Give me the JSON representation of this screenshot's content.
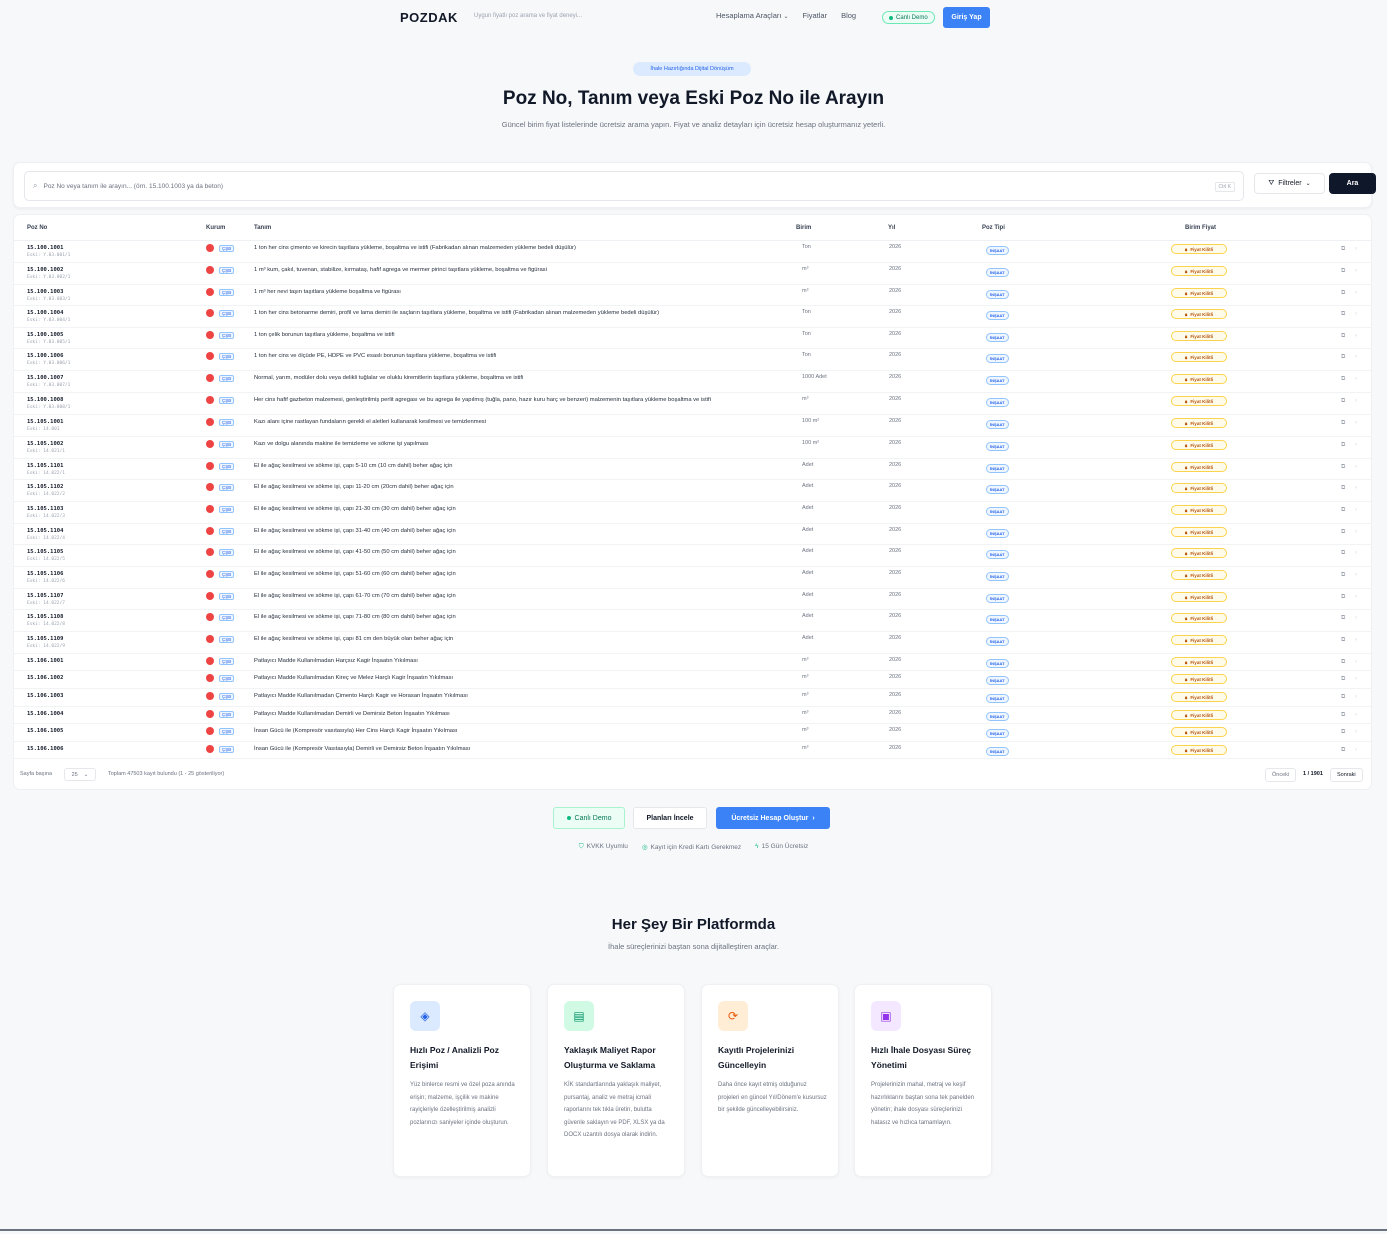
{
  "header": {
    "logo": "POZDAK",
    "search_hint": "Uygun fiyatlı poz arama ve fiyat deneyi...",
    "nav": [
      "Hesaplama Araçları",
      "Fiyatlar",
      "Blog"
    ],
    "demo_label": "Canlı Demo",
    "login_label": "Giriş Yap"
  },
  "hero": {
    "badge": "İhale Hazırlığında Dijital Dönüşüm",
    "title": "Poz No, Tanım veya Eski Poz No ile Arayın",
    "subtitle": "Güncel birim fiyat listelerinde ücretsiz arama yapın. Fiyat ve analiz detayları için ücretsiz hesap oluşturmanız yeterli."
  },
  "search": {
    "placeholder": "Poz No veya tanım ile arayın... (örn. 15.100.1003 ya da beton)",
    "kbd": "Ctrl K",
    "filters_label": "Filtreler",
    "search_label": "Ara"
  },
  "table": {
    "columns": [
      "Poz No",
      "Kurum",
      "Tanım",
      "Birim",
      "Yıl",
      "Poz Tipi",
      "Birim Fiyat"
    ],
    "inst_label": "ÇŞB",
    "type_label": "İNŞAAT",
    "price_label": "Fiyat Kilitli",
    "rows": [
      {
        "code": "15.100.1001",
        "old": "Eski: Y.03.001/1",
        "desc": "1 ton her cins çimento ve kirecin taşıtlara yükleme, boşaltma ve istifi (Fabrikadan alınan malzemeden yükleme bedeli düşülür)",
        "unit": "Ton",
        "year": "2026"
      },
      {
        "code": "15.100.1002",
        "old": "Eski: Y.03.002/1",
        "desc": "1 m³ kum, çakıl, tuvenan, stabilize, kırmataş, hafif agrega ve mermer pirinci taşıtlara yükleme, boşaltma ve figürasi",
        "unit": "m³",
        "year": "2026"
      },
      {
        "code": "15.100.1003",
        "old": "Eski: Y.03.003/1",
        "desc": "1 m³ her nevi taşın taşıtlara yükleme boşaltma ve figürası",
        "unit": "m³",
        "year": "2026"
      },
      {
        "code": "15.100.1004",
        "old": "Eski: Y.03.004/1",
        "desc": "1 ton her cins betonarme demiri, profil ve lama demiri ile saçların taşıtlara yükleme, boşaltma ve istifi (Fabrikadan alınan malzemeden yükleme bedeli düşülür)",
        "unit": "Ton",
        "year": "2026"
      },
      {
        "code": "15.100.1005",
        "old": "Eski: Y.03.005/1",
        "desc": "1 ton çelik borunun taşıtlara yükleme, boşaltma ve istifi",
        "unit": "Ton",
        "year": "2026"
      },
      {
        "code": "15.100.1006",
        "old": "Eski: Y.03.006/1",
        "desc": "1 ton her cins ve ölçüde PE, HDPE ve PVC esaslı borunun taşıtlara yükleme, boşaltma ve istifi",
        "unit": "Ton",
        "year": "2026"
      },
      {
        "code": "15.100.1007",
        "old": "Eski: Y.03.007/1",
        "desc": "Normal, yarım, modüler dolu veya delikli tuğlalar ve oluklu kiremitlerin taşıtlara yükleme, boşaltma ve istifi",
        "unit": "1000 Adet",
        "year": "2026"
      },
      {
        "code": "15.100.1008",
        "old": "Eski: Y.03.008/1",
        "desc": "Her cins hafif gazbeton malzemesi, genleştirilmiş perlit agregası ve bu agrega ile yapılmış (tuğla, pano, hazır kuru harç ve benzeri) malzemenin taşıtlara yükleme boşaltma ve istifi",
        "unit": "m³",
        "year": "2026"
      },
      {
        "code": "15.105.1001",
        "old": "Eski: 14.001",
        "desc": "Kazı alanı içine rastlayan fundaların gerekli el aletleri kullanarak kesilmesi ve temizlenmesi",
        "unit": "100 m²",
        "year": "2026"
      },
      {
        "code": "15.105.1002",
        "old": "Eski: 14.021/1",
        "desc": "Kazı ve dolgu alanında makine ile temizleme ve sökme işi yapılması",
        "unit": "100 m²",
        "year": "2026"
      },
      {
        "code": "15.105.1101",
        "old": "Eski: 14.022/1",
        "desc": "El ile ağaç kesilmesi ve sökme işi, çapı 5-10 cm (10 cm dahil) beher ağaç için",
        "unit": "Adet",
        "year": "2026"
      },
      {
        "code": "15.105.1102",
        "old": "Eski: 14.022/2",
        "desc": "El ile ağaç kesilmesi ve sökme işi, çapı 11-20 cm (20cm dahil) beher ağaç için",
        "unit": "Adet",
        "year": "2026"
      },
      {
        "code": "15.105.1103",
        "old": "Eski: 14.022/3",
        "desc": "El ile ağaç kesilmesi ve sökme işi, çapı 21-30 cm (30 cm dahil) beher ağaç için",
        "unit": "Adet",
        "year": "2026"
      },
      {
        "code": "15.105.1104",
        "old": "Eski: 14.022/4",
        "desc": "El ile ağaç kesilmesi ve sökme işi, çapı 31-40 cm (40 cm dahil) beher ağaç için",
        "unit": "Adet",
        "year": "2026"
      },
      {
        "code": "15.105.1105",
        "old": "Eski: 14.022/5",
        "desc": "El ile ağaç kesilmesi ve sökme işi, çapı 41-50 cm (50 cm dahil) beher ağaç için",
        "unit": "Adet",
        "year": "2026"
      },
      {
        "code": "15.105.1106",
        "old": "Eski: 14.022/6",
        "desc": "El ile ağaç kesilmesi ve sökme işi, çapı 51-60 cm (60 cm dahil) beher ağaç için",
        "unit": "Adet",
        "year": "2026"
      },
      {
        "code": "15.105.1107",
        "old": "Eski: 14.022/7",
        "desc": "El ile ağaç kesilmesi ve sökme işi, çapı 61-70 cm (70 cm dahil) beher ağaç için",
        "unit": "Adet",
        "year": "2026"
      },
      {
        "code": "15.105.1108",
        "old": "Eski: 14.022/8",
        "desc": "El ile ağaç kesilmesi ve sökme işi, çapı 71-80 cm (80 cm dahil) beher ağaç için",
        "unit": "Adet",
        "year": "2026"
      },
      {
        "code": "15.105.1109",
        "old": "Eski: 14.022/9",
        "desc": "El ile ağaç kesilmesi ve sökme işi, çapı 81 cm den büyük olan beher ağaç için",
        "unit": "Adet",
        "year": "2026"
      },
      {
        "code": "15.106.1001",
        "old": "",
        "desc": "Patlayıcı Madde Kullanılmadan Harçsız Kagir İnşaatın Yıkılması",
        "unit": "m³",
        "year": "2026"
      },
      {
        "code": "15.106.1002",
        "old": "",
        "desc": "Patlayıcı Madde Kullanılmadan Kireç ve Melez Harçlı Kagir İnşaatın Yıkılması",
        "unit": "m³",
        "year": "2026"
      },
      {
        "code": "15.106.1003",
        "old": "",
        "desc": "Patlayıcı Madde Kullanılmadan Çimento Harçlı Kagir ve Horasan İnşaatın Yıkılması",
        "unit": "m³",
        "year": "2026"
      },
      {
        "code": "15.106.1004",
        "old": "",
        "desc": "Patlayıcı Madde Kullanılmadan Demirli ve Demirsiz Beton İnşaatın Yıkılması",
        "unit": "m³",
        "year": "2026"
      },
      {
        "code": "15.106.1005",
        "old": "",
        "desc": "İnsan Gücü ile (Kompresör vasıtasıyla) Her Cins Harçlı Kagir İnşaatın Yıkılması",
        "unit": "m³",
        "year": "2026"
      },
      {
        "code": "15.106.1006",
        "old": "",
        "desc": "İnsan Gücü ile (Kompresör Vasıtasıyla) Demirli ve Demirsiz Beton İnşaatın Yıkılması",
        "unit": "m³",
        "year": "2026"
      }
    ],
    "footer": {
      "page_size_label": "Sayfa başına",
      "page_size": "25",
      "summary": "Toplam 47503 kayıt bulundu (1 - 25 gösteriliyor)",
      "prev": "Önceki",
      "page": "1 / 1901",
      "next": "Sonraki"
    }
  },
  "cta": {
    "demo": "Canlı Demo",
    "plans": "Planları İncele",
    "signup": "Ücretsiz Hesap Oluştur"
  },
  "trust": [
    "KVKK Uyumlu",
    "Kayıt için Kredi Kartı Gerekmez",
    "15 Gün Ücretsiz"
  ],
  "features_section": {
    "title": "Her Şey Bir Platformda",
    "subtitle": "İhale süreçlerinizi baştan sona dijitalleştiren araçlar.",
    "cards": [
      {
        "title": "Hızlı Poz / Analizli Poz Erişimi",
        "text": "Yüz binlerce resmi ve özel poza anında erişin; malzeme, işçilik ve makine rayiçleriyle özelleştirilmiş analizli pozlarınızı saniyeler içinde oluşturun.",
        "color": "#dbeafe",
        "icon": "layers-icon"
      },
      {
        "title": "Yaklaşık Maliyet Rapor Oluşturma ve Saklama",
        "text": "KİK standartlarında yaklaşık maliyet, pursantaj, analiz ve metraj icmali raporlarını tek tıkla üretin, bulutta güvenle saklayın ve PDF, XLSX ya da DOCX uzantılı dosya olarak indirin.",
        "color": "#d1fae5",
        "icon": "sheet-icon"
      },
      {
        "title": "Kayıtlı Projelerinizi Güncelleyin",
        "text": "Daha önce kayıt etmiş olduğunuz projeleri en güncel Yıl/Dönem'e kusursuz bir şekilde güncelleyebilirsiniz.",
        "color": "#ffedd5",
        "icon": "refresh-icon"
      },
      {
        "title": "Hızlı İhale Dosyası Süreç Yönetimi",
        "text": "Projelerinizin mahal, metraj ve keşif hazırlıklarını baştan sona tek panelden yönetin; ihale dosyası süreçlerinizi hatasız ve hızlıca tamamlayın.",
        "color": "#f3e8ff",
        "icon": "folder-icon"
      }
    ]
  }
}
